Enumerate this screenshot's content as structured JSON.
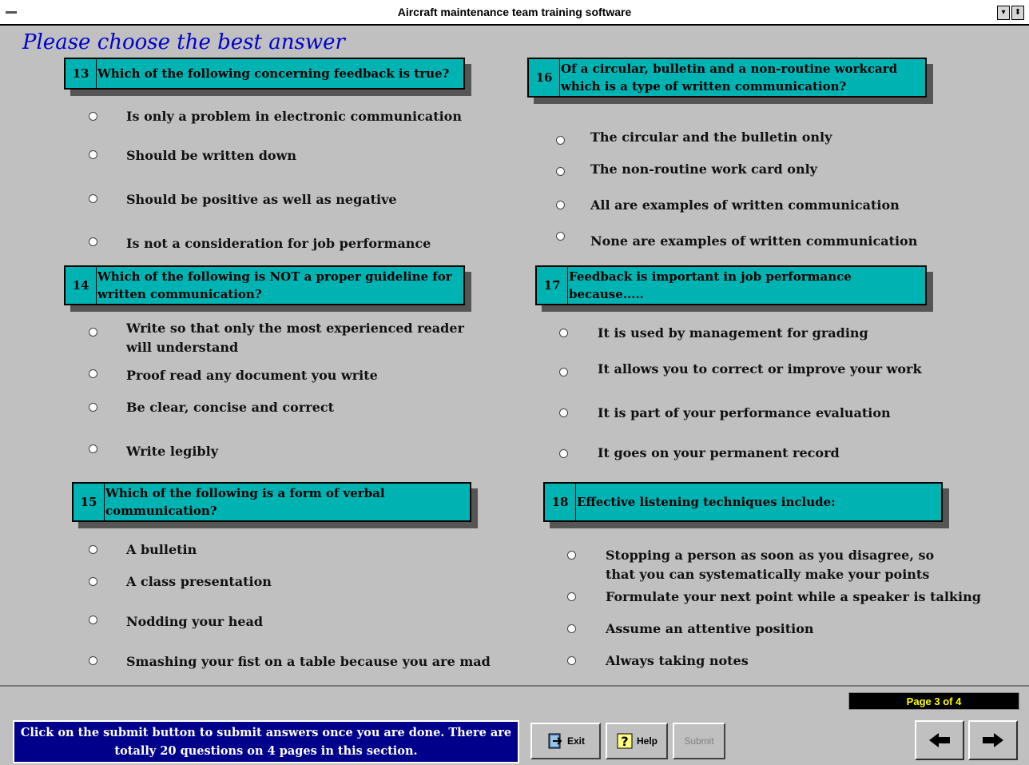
{
  "window": {
    "title": "Aircraft maintenance team training software",
    "minimize_glyph": "▾",
    "maximize_glyph": "⬍"
  },
  "instruction": "Please choose the best answer",
  "questions": [
    {
      "number": "13",
      "text": "Which of the following concerning feedback is true?",
      "options": [
        "Is only a problem in electronic communication",
        "Should be written down",
        "Should be positive as well as negative",
        "Is not a consideration for job performance"
      ]
    },
    {
      "number": "14",
      "text": "Which of the following is NOT a proper guideline for written communication?",
      "options": [
        "Write so that only the most experienced reader will understand",
        "Proof read any document you write",
        "Be clear, concise and correct",
        "Write legibly"
      ]
    },
    {
      "number": "15",
      "text": "Which of the following is a form of verbal communication?",
      "options": [
        "A bulletin",
        "A class presentation",
        "Nodding your head",
        "Smashing your fist on a table because you are mad"
      ]
    },
    {
      "number": "16",
      "text": "Of a circular, bulletin and a non-routine workcard which is a type of written communication?",
      "options": [
        "The circular and the bulletin only",
        "The non-routine work card only",
        "All are examples of written communication",
        "None are examples of written communication"
      ]
    },
    {
      "number": "17",
      "text": "Feedback is important in job performance because.....",
      "options": [
        "It is used by management for grading",
        "It allows you to correct or improve your work",
        "It is part of your performance evaluation",
        "It goes on your permanent record"
      ]
    },
    {
      "number": "18",
      "text": "Effective listening techniques include:",
      "options": [
        "Stopping a person as soon as you disagree, so that you can systematically make your points",
        "Formulate your next point while a speaker is talking",
        "Assume an attentive position",
        "Always taking notes"
      ]
    }
  ],
  "footer": {
    "info": "Click on the submit button to submit answers once you are done. There are totally 20 questions on 4 pages in this section.",
    "page_indicator": "Page 3 of 4",
    "buttons": {
      "exit": "Exit",
      "help": "Help",
      "submit": "Submit"
    }
  },
  "icons": {
    "exit": "exit-icon",
    "help": "help-icon",
    "prev": "arrow-left-icon",
    "next": "arrow-right-icon"
  },
  "colors": {
    "question_bg": "#00b3b3",
    "instruction_text": "#0000cc",
    "info_bg": "#00008b",
    "page_indicator_text": "#ffff00"
  }
}
